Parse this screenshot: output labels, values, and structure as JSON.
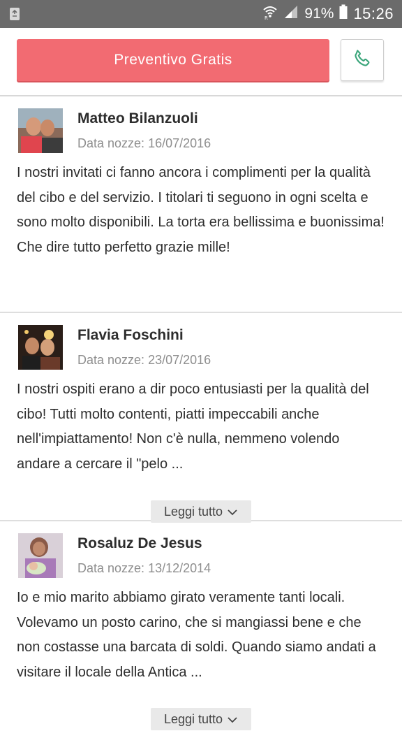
{
  "status_bar": {
    "battery_percent": "91%",
    "time": "15:26",
    "icons": [
      "recycle-notification-icon",
      "wifi-icon",
      "signal-icon",
      "battery-icon"
    ]
  },
  "topbar": {
    "quote_button_label": "Preventivo Gratis",
    "call_icon": "phone-icon",
    "accent_color": "#f26b72",
    "phone_icon_color": "#3aa57a"
  },
  "reviews": [
    {
      "name": "Matteo Bilanzuoli",
      "date_label": "Data nozze:",
      "date": "16/07/2016",
      "text": "I nostri invitati ci fanno ancora i complimenti per la qualità del cibo e del servizio. I titolari ti seguono in ogni scelta e sono molto disponibili. La torta era bellissima e buonissima! Che dire tutto perfetto grazie mille!"
    },
    {
      "name": "Flavia Foschini",
      "date_label": "Data nozze:",
      "date": "23/07/2016",
      "text": "I nostri ospiti erano a dir poco entusiasti per la qualità del cibo! Tutti molto contenti, piatti impeccabili anche nell'impiattamento! Non c'è nulla, nemmeno volendo andare a cercare il \"pelo ...",
      "read_more": "Leggi tutto"
    },
    {
      "name": "Rosaluz De Jesus",
      "date_label": "Data nozze:",
      "date": "13/12/2014",
      "text": "Io e mio marito abbiamo girato veramente tanti locali. Volevamo un posto carino, che si mangiassi bene e che non costasse una barcata di soldi. Quando siamo andati a visitare il locale della Antica ...",
      "read_more": "Leggi tutto"
    }
  ]
}
